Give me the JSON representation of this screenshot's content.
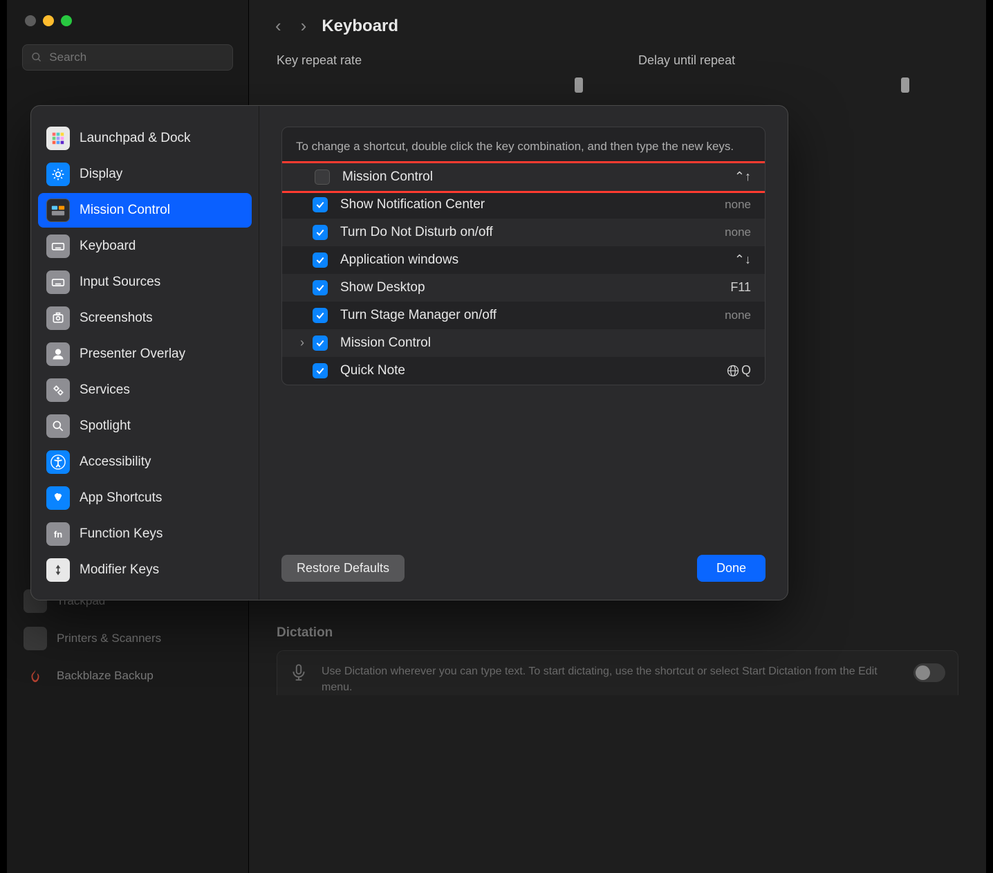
{
  "header": {
    "title": "Keyboard",
    "search_placeholder": "Search"
  },
  "main_settings": {
    "key_repeat_label": "Key repeat rate",
    "delay_repeat_label": "Delay until repeat"
  },
  "dictation": {
    "heading": "Dictation",
    "description": "Use Dictation wherever you can type text. To start dictating, use the shortcut or select Start Dictation from the Edit menu."
  },
  "bg_sidebar": {
    "trackpad": "Trackpad",
    "printers": "Printers & Scanners",
    "backblaze": "Backblaze Backup"
  },
  "modal": {
    "help_text": "To change a shortcut, double click the key combination, and then type the new keys.",
    "restore_label": "Restore Defaults",
    "done_label": "Done",
    "categories": [
      {
        "label": "Launchpad & Dock",
        "icon": "grid",
        "color": "ci-white"
      },
      {
        "label": "Display",
        "icon": "sun",
        "color": "ci-blue"
      },
      {
        "label": "Mission Control",
        "icon": "mc",
        "color": "ci-dark",
        "selected": true
      },
      {
        "label": "Keyboard",
        "icon": "kbd",
        "color": "ci-grey"
      },
      {
        "label": "Input Sources",
        "icon": "kbd",
        "color": "ci-grey"
      },
      {
        "label": "Screenshots",
        "icon": "cam",
        "color": "ci-grey"
      },
      {
        "label": "Presenter Overlay",
        "icon": "person",
        "color": "ci-grey"
      },
      {
        "label": "Services",
        "icon": "gears",
        "color": "ci-grey"
      },
      {
        "label": "Spotlight",
        "icon": "search",
        "color": "ci-grey"
      },
      {
        "label": "Accessibility",
        "icon": "a11y",
        "color": "ci-blue"
      },
      {
        "label": "App Shortcuts",
        "icon": "app",
        "color": "ci-blue"
      },
      {
        "label": "Function Keys",
        "icon": "fn",
        "color": "ci-grey"
      },
      {
        "label": "Modifier Keys",
        "icon": "mod",
        "color": "ci-white"
      }
    ],
    "shortcuts": [
      {
        "label": "Mission Control",
        "checked": false,
        "key": "⌃↑",
        "highlighted": true
      },
      {
        "label": "Show Notification Center",
        "checked": true,
        "key": "none",
        "dim": true
      },
      {
        "label": "Turn Do Not Disturb on/off",
        "checked": true,
        "key": "none",
        "dim": true
      },
      {
        "label": "Application windows",
        "checked": true,
        "key": "⌃↓"
      },
      {
        "label": "Show Desktop",
        "checked": true,
        "key": "F11"
      },
      {
        "label": "Turn Stage Manager on/off",
        "checked": true,
        "key": "none",
        "dim": true
      },
      {
        "label": "Mission Control",
        "checked": true,
        "key": "",
        "disclosure": true
      },
      {
        "label": "Quick Note",
        "checked": true,
        "key": "🌐Q",
        "globe": true
      }
    ]
  }
}
